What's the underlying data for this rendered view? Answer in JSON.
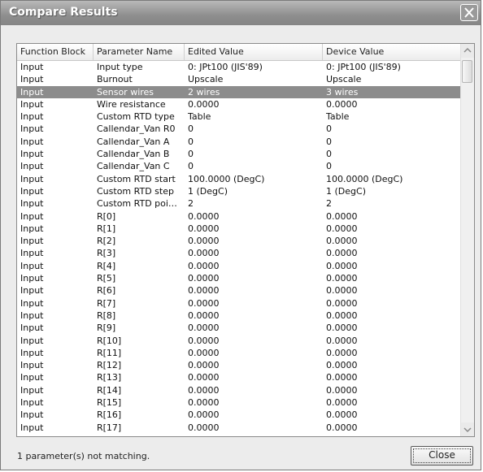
{
  "window": {
    "title": "Compare Results"
  },
  "table": {
    "columns": [
      "Function Block",
      "Parameter Name",
      "Edited Value",
      "Device Value"
    ],
    "selected_row": 2,
    "rows": [
      [
        "Input",
        "Input type",
        "0: JPt100 (JIS'89)",
        "0: JPt100 (JIS'89)"
      ],
      [
        "Input",
        "Burnout",
        "Upscale",
        "Upscale"
      ],
      [
        "Input",
        "Sensor wires",
        "2 wires",
        "3 wires"
      ],
      [
        "Input",
        "Wire resistance",
        "0.0000",
        "0.0000"
      ],
      [
        "Input",
        "Custom RTD type",
        "Table",
        "Table"
      ],
      [
        "Input",
        "Callendar_Van R0",
        "0",
        "0"
      ],
      [
        "Input",
        "Callendar_Van A",
        "0",
        "0"
      ],
      [
        "Input",
        "Callendar_Van B",
        "0",
        "0"
      ],
      [
        "Input",
        "Callendar_Van C",
        "0",
        "0"
      ],
      [
        "Input",
        "Custom RTD start",
        "100.0000 (DegC)",
        "100.0000 (DegC)"
      ],
      [
        "Input",
        "Custom RTD step",
        "1 (DegC)",
        "1 (DegC)"
      ],
      [
        "Input",
        "Custom RTD poi…",
        "2",
        "2"
      ],
      [
        "Input",
        "R[0]",
        "0.0000",
        "0.0000"
      ],
      [
        "Input",
        "R[1]",
        "0.0000",
        "0.0000"
      ],
      [
        "Input",
        "R[2]",
        "0.0000",
        "0.0000"
      ],
      [
        "Input",
        "R[3]",
        "0.0000",
        "0.0000"
      ],
      [
        "Input",
        "R[4]",
        "0.0000",
        "0.0000"
      ],
      [
        "Input",
        "R[5]",
        "0.0000",
        "0.0000"
      ],
      [
        "Input",
        "R[6]",
        "0.0000",
        "0.0000"
      ],
      [
        "Input",
        "R[7]",
        "0.0000",
        "0.0000"
      ],
      [
        "Input",
        "R[8]",
        "0.0000",
        "0.0000"
      ],
      [
        "Input",
        "R[9]",
        "0.0000",
        "0.0000"
      ],
      [
        "Input",
        "R[10]",
        "0.0000",
        "0.0000"
      ],
      [
        "Input",
        "R[11]",
        "0.0000",
        "0.0000"
      ],
      [
        "Input",
        "R[12]",
        "0.0000",
        "0.0000"
      ],
      [
        "Input",
        "R[13]",
        "0.0000",
        "0.0000"
      ],
      [
        "Input",
        "R[14]",
        "0.0000",
        "0.0000"
      ],
      [
        "Input",
        "R[15]",
        "0.0000",
        "0.0000"
      ],
      [
        "Input",
        "R[16]",
        "0.0000",
        "0.0000"
      ],
      [
        "Input",
        "R[17]",
        "0.0000",
        "0.0000"
      ]
    ]
  },
  "status": {
    "text": "1 parameter(s) not matching."
  },
  "buttons": {
    "close": "Close"
  },
  "icons": {
    "title_close": "close-icon",
    "scroll_up": "chevron-up-icon",
    "scroll_down": "chevron-down-icon"
  }
}
